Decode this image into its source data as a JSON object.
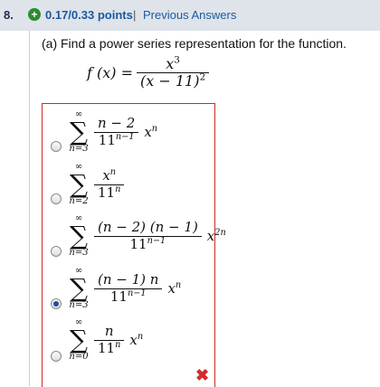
{
  "header": {
    "question_number": "8.",
    "points": "0.17/0.33 points",
    "separator": "|",
    "previous_answers": "Previous Answers"
  },
  "prompt": "(a) Find a power series representation for the function.",
  "function": {
    "lhs": "f (x) =",
    "numerator_base": "x",
    "numerator_exp": "3",
    "denominator": "(x − 11)",
    "denominator_exp": "2"
  },
  "options": [
    {
      "lower": "n=3",
      "upper": "∞",
      "num": "n − 2",
      "den_base": "11",
      "den_exp": "n−1",
      "x_exp": "n",
      "selected": false
    },
    {
      "lower": "n=2",
      "upper": "∞",
      "num_base": "x",
      "num_exp": "n",
      "den_base": "11",
      "den_exp": "n",
      "selected": false
    },
    {
      "lower": "n=3",
      "upper": "∞",
      "num": "(n − 2) (n − 1)",
      "den_base": "11",
      "den_exp": "n−1",
      "x_exp": "2n",
      "selected": false
    },
    {
      "lower": "n=3",
      "upper": "∞",
      "num": "(n − 1) n",
      "den_base": "11",
      "den_exp": "n−1",
      "x_exp": "n",
      "selected": true
    },
    {
      "lower": "n=0",
      "upper": "∞",
      "num": "n",
      "den_base": "11",
      "den_exp": "n",
      "x_exp": "n",
      "selected": false
    }
  ],
  "status_icon": "incorrect-x-icon",
  "status_symbol": "✖",
  "colors": {
    "header_bg": "#dfe3ea",
    "link": "#1a5aa0",
    "error": "#cc2a2a",
    "correct_plus": "#2e8b2e"
  }
}
